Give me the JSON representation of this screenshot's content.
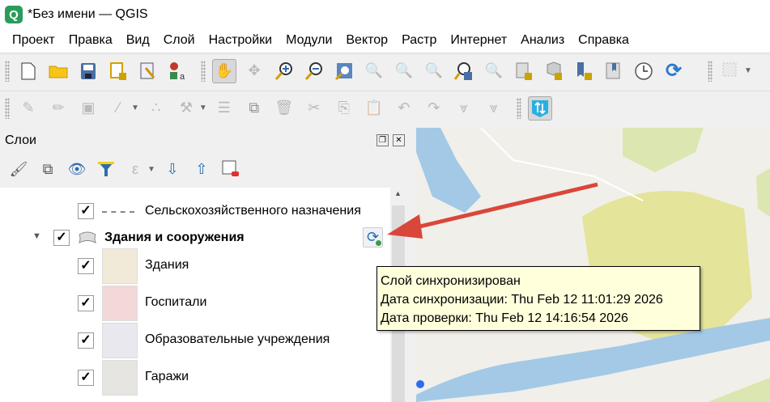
{
  "window": {
    "title": "*Без имени — QGIS",
    "logo": "Q"
  },
  "menu": [
    "Проект",
    "Правка",
    "Вид",
    "Слой",
    "Настройки",
    "Модули",
    "Вектор",
    "Растр",
    "Интернет",
    "Анализ",
    "Справка"
  ],
  "toolbar1": [
    "new-project",
    "open-project",
    "save-project",
    "new-print-layout",
    "layout-manager",
    "style-manager",
    "pan",
    "pan-to-selection",
    "zoom-in",
    "zoom-out",
    "zoom-full",
    "zoom-to-selection",
    "zoom-to-layer",
    "zoom-native",
    "zoom-last",
    "zoom-next",
    "new-bookmark",
    "show-bookmarks",
    "bookmark-add",
    "bookmarks",
    "temporal-controller",
    "refresh",
    "select-features"
  ],
  "toolbar2": [
    "current-edits",
    "toggle-editing",
    "save-edits",
    "digitize-line",
    "vertex-tool",
    "modify-attributes",
    "delete",
    "cut",
    "copy",
    "paste",
    "undo",
    "redo",
    "digitize",
    "digitize2",
    "sync"
  ],
  "layers_panel": {
    "title": "Слои",
    "items": [
      {
        "label": "Сельскохозяйственного назначения",
        "checked": true,
        "symbol": "dashed-line"
      },
      {
        "label": "Здания и сооружения",
        "checked": true,
        "group": true,
        "expanded": true
      },
      {
        "label": "Здания",
        "checked": true,
        "color": "#f2ead8"
      },
      {
        "label": "Госпитали",
        "checked": true,
        "color": "#f2d8d8"
      },
      {
        "label": "Образовательные учреждения",
        "checked": true,
        "color": "#e8e8ee"
      },
      {
        "label": "Гаражи",
        "checked": true,
        "color": "#e6e5e1"
      }
    ]
  },
  "tooltip": {
    "line1": "Слой синхронизирован",
    "line2": "Дата синхронизации: Thu Feb 12 11:01:29 2026",
    "line3": "Дата проверки: Thu Feb 12 14:16:54 2026"
  },
  "colors": {
    "water": "#a3c9e6",
    "green": "#dce6b0",
    "yellow": "#e4e49a",
    "arrow": "#d9473a"
  }
}
